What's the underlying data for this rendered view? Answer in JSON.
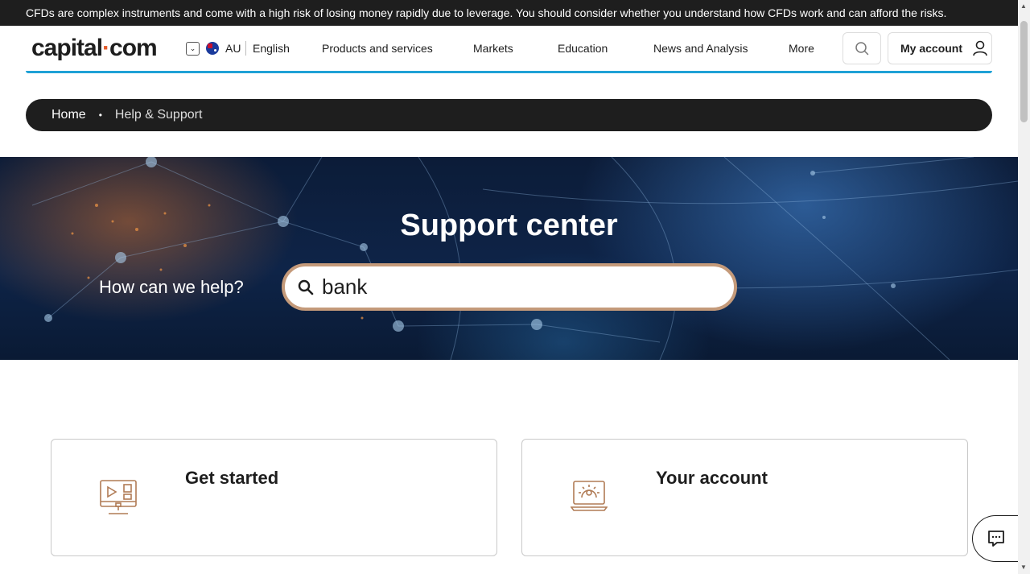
{
  "risk_warning": "CFDs are complex instruments and come with a high risk of losing money rapidly due to leverage. You should consider whether you understand how CFDs work and can afford the risks.",
  "header": {
    "logo_left": "capital",
    "logo_dot": "·",
    "logo_right": "com",
    "region": "AU",
    "language": "English",
    "nav": [
      "Products and services",
      "Markets",
      "Education",
      "News and Analysis",
      "More"
    ],
    "account_label": "My account"
  },
  "breadcrumb": {
    "home": "Home",
    "separator": "•",
    "current": "Help & Support"
  },
  "hero": {
    "title": "Support center",
    "prompt": "How can we help?",
    "search_value": "bank"
  },
  "cards": [
    {
      "title": "Get started",
      "icon": "monitor-play-icon"
    },
    {
      "title": "Your account",
      "icon": "laptop-gear-icon"
    }
  ],
  "colors": {
    "dark": "#1e1e1e",
    "accent_line": "#1fa1d6",
    "icon_brown": "#b07b55",
    "search_border": "#c49a7a"
  }
}
